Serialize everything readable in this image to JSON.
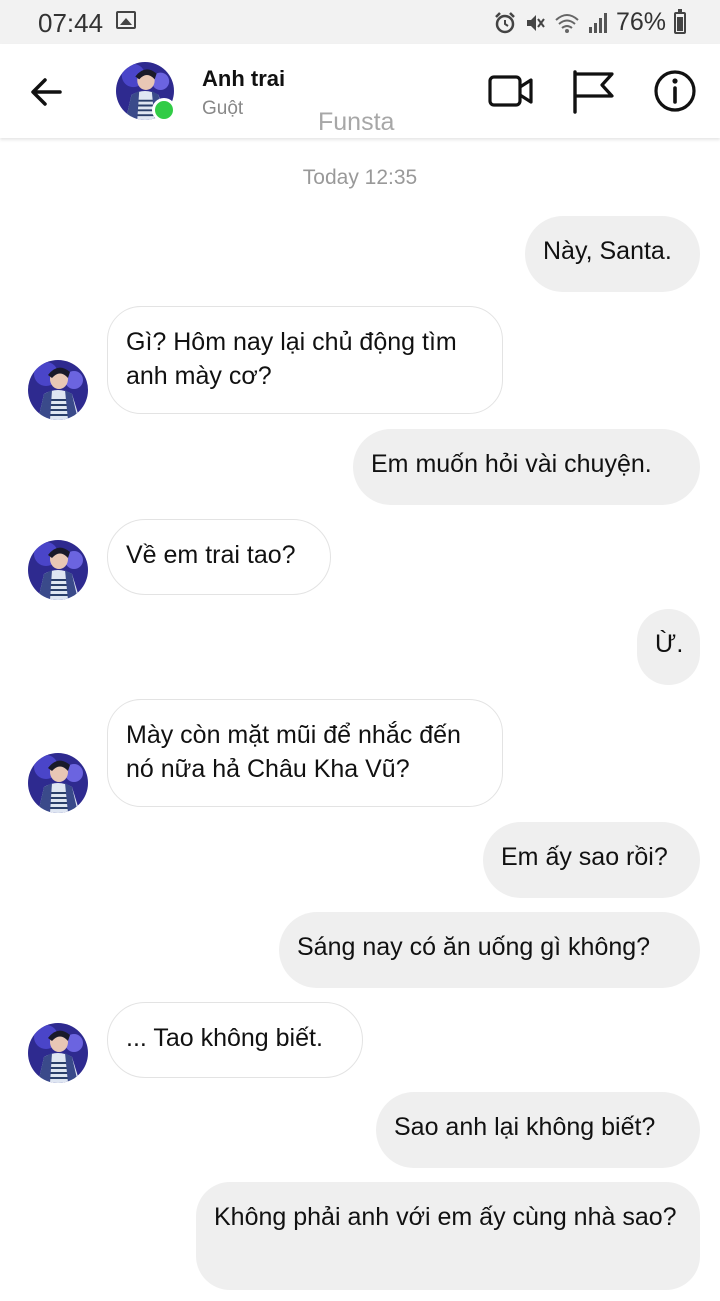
{
  "status_bar": {
    "time": "07:44",
    "battery": "76%",
    "icons": [
      "gallery-icon",
      "alarm-icon",
      "mute-icon",
      "wifi-icon",
      "signal-icon",
      "battery-icon"
    ]
  },
  "header": {
    "name": "Anh trai",
    "subtitle": "Guột",
    "watermark": "Funsta",
    "icons": [
      "back-arrow-icon",
      "video-call-icon",
      "flag-icon",
      "info-icon"
    ]
  },
  "conversation": {
    "timestamp": "Today 12:35",
    "messages": [
      {
        "side": "out",
        "text": "Này, Santa."
      },
      {
        "side": "in",
        "text": "Gì? Hôm nay lại chủ động tìm anh mày cơ?"
      },
      {
        "side": "out",
        "text": "Em muốn hỏi vài chuyện."
      },
      {
        "side": "in",
        "text": "Về em trai tao?"
      },
      {
        "side": "out",
        "text": "Ừ."
      },
      {
        "side": "in",
        "text": "Mày còn mặt mũi để nhắc đến nó nữa hả Châu Kha Vũ?"
      },
      {
        "side": "out",
        "text": "Em ấy sao rồi?"
      },
      {
        "side": "out",
        "text": "Sáng nay có ăn uống gì không?"
      },
      {
        "side": "in",
        "text": "... Tao không biết."
      },
      {
        "side": "out",
        "text": "Sao anh lại không biết?"
      },
      {
        "side": "out",
        "text": "Không phải anh với em ấy cùng nhà sao?"
      }
    ]
  },
  "colors": {
    "outgoing_bubble": "#efefef",
    "incoming_bubble": "#ffffff",
    "online_dot": "#31cc46"
  }
}
